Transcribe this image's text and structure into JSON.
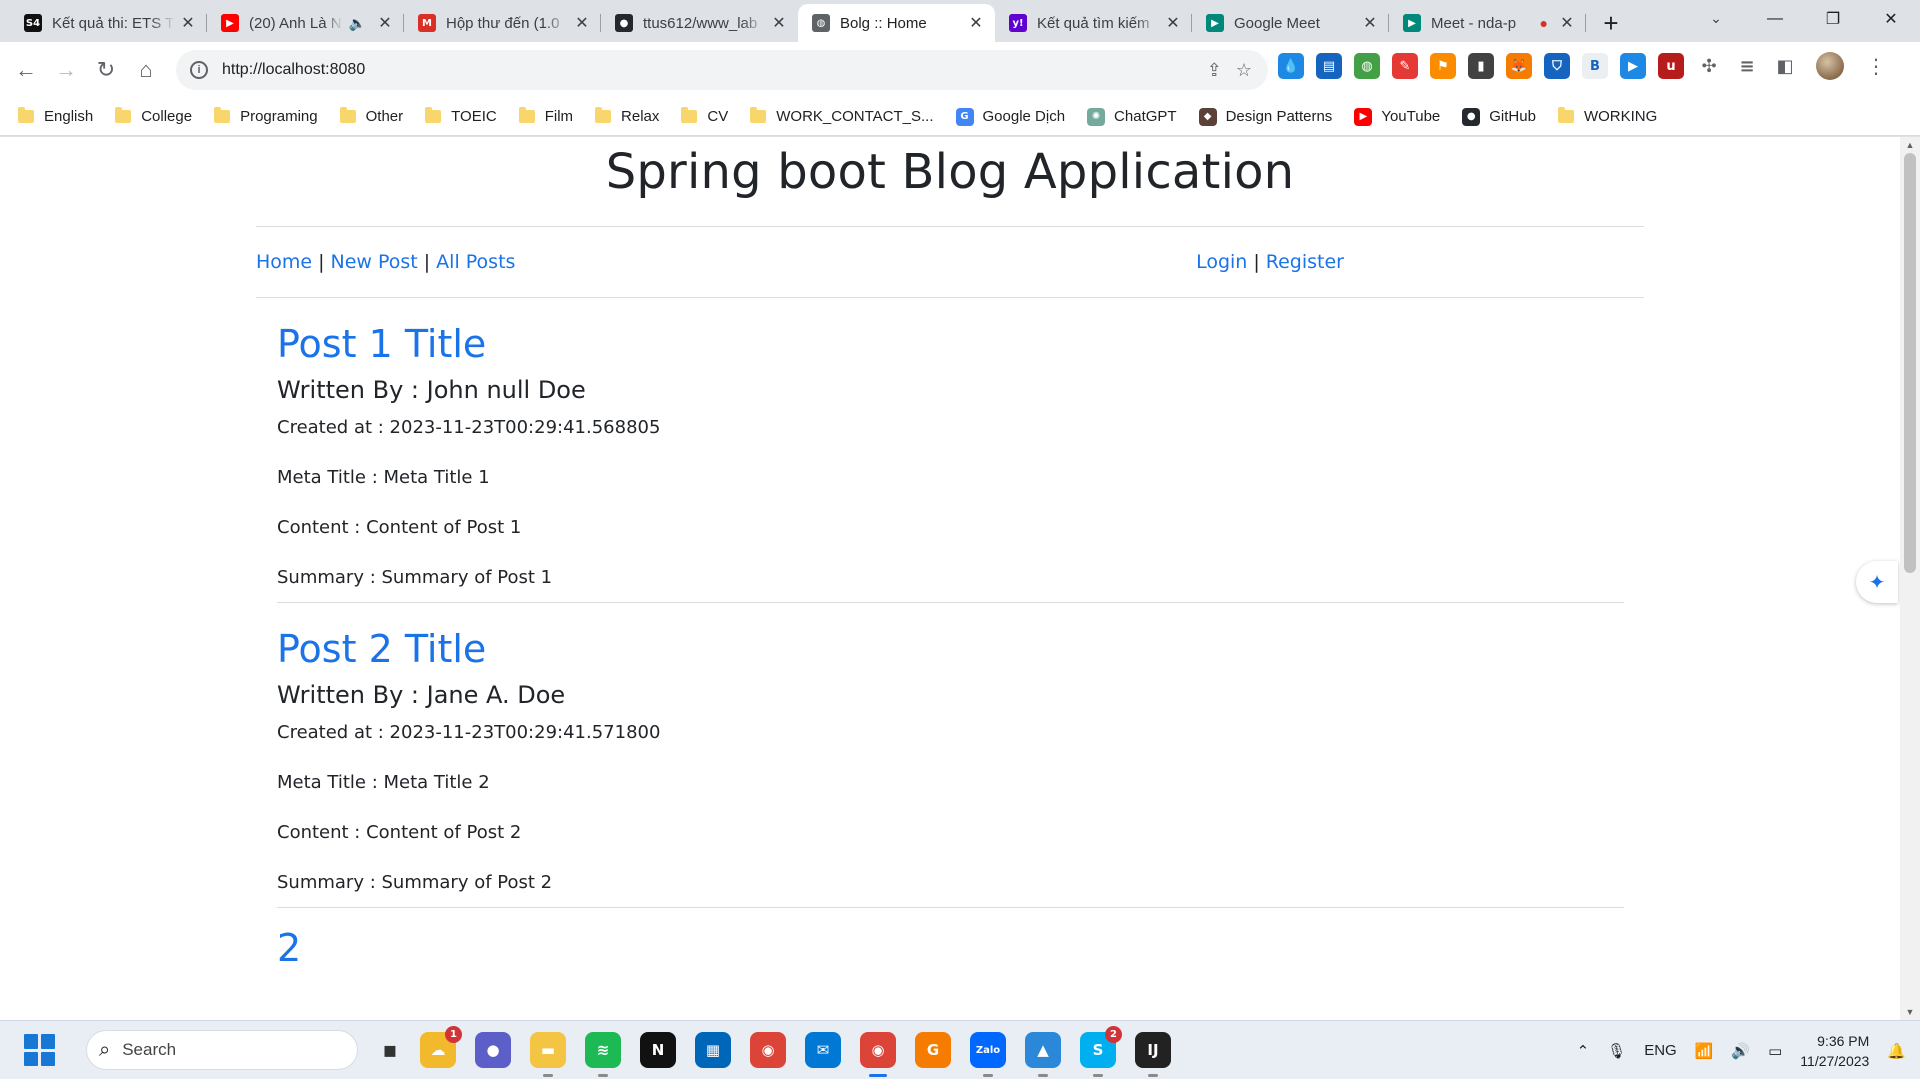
{
  "browser": {
    "tabs": [
      {
        "title": "Kết quả thi: ETS T",
        "icon": "s4-icon",
        "icon_text": "S4",
        "color": "#111111"
      },
      {
        "title": "(20) Anh Là N",
        "icon": "youtube-icon",
        "icon_text": "▶",
        "color": "#ff0000",
        "extra": "🔈"
      },
      {
        "title": "Hộp thư đến (1.0",
        "icon": "gmail-icon",
        "icon_text": "M",
        "color": "#d93025"
      },
      {
        "title": "ttus612/www_lab",
        "icon": "github-icon",
        "icon_text": "●",
        "color": "#24292f"
      },
      {
        "title": "Bolg :: Home",
        "icon": "globe-icon",
        "icon_text": "◍",
        "color": "#5f6368",
        "active": true
      },
      {
        "title": "Kết quả tìm kiếm",
        "icon": "yahoo-icon",
        "icon_text": "y!",
        "color": "#6001d2"
      },
      {
        "title": "Google Meet",
        "icon": "meet-icon",
        "icon_text": "▶",
        "color": "#00897b"
      },
      {
        "title": "Meet - nda-p",
        "icon": "meet-icon",
        "icon_text": "▶",
        "color": "#00897b",
        "extra": "●"
      }
    ],
    "url": "http://localhost:8080",
    "bookmarks": [
      {
        "label": "English",
        "type": "folder"
      },
      {
        "label": "College",
        "type": "folder"
      },
      {
        "label": "Programing",
        "type": "folder"
      },
      {
        "label": "Other",
        "type": "folder"
      },
      {
        "label": "TOEIC",
        "type": "folder"
      },
      {
        "label": "Film",
        "type": "folder"
      },
      {
        "label": "Relax",
        "type": "folder"
      },
      {
        "label": "CV",
        "type": "folder"
      },
      {
        "label": "WORK_CONTACT_S...",
        "type": "folder"
      },
      {
        "label": "Google Dịch",
        "type": "link",
        "icon": "google-translate-icon",
        "color": "#4285f4",
        "icon_text": "G"
      },
      {
        "label": "ChatGPT",
        "type": "link",
        "icon": "chatgpt-icon",
        "color": "#74aa9c",
        "icon_text": "✺"
      },
      {
        "label": "Design Patterns",
        "type": "link",
        "icon": "design-patterns-icon",
        "color": "#5d4037",
        "icon_text": "◆"
      },
      {
        "label": "YouTube",
        "type": "link",
        "icon": "youtube-icon",
        "color": "#ff0000",
        "icon_text": "▶"
      },
      {
        "label": "GitHub",
        "type": "link",
        "icon": "github-icon",
        "color": "#24292f",
        "icon_text": "●"
      },
      {
        "label": "WORKING",
        "type": "folder"
      }
    ]
  },
  "site": {
    "title": "Spring boot Blog Application",
    "nav_left": [
      "Home",
      "New Post",
      "All Posts"
    ],
    "nav_right": [
      "Login",
      "Register"
    ],
    "nav_separator": "|",
    "posts": [
      {
        "title": "Post 1 Title",
        "author": "Written By : John null Doe",
        "created": "Created at : 2023-11-23T00:29:41.568805",
        "meta": "Meta Title : Meta Title 1",
        "content": "Content : Content of Post 1",
        "summary": "Summary : Summary of Post 1"
      },
      {
        "title": "Post 2 Title",
        "author": "Written By : Jane A. Doe",
        "created": "Created at : 2023-11-23T00:29:41.571800",
        "meta": "Meta Title : Meta Title 2",
        "content": "Content : Content of Post 2",
        "summary": "Summary : Summary of Post 2"
      }
    ],
    "pager": "2"
  },
  "taskbar": {
    "search_placeholder": "Search",
    "apps": [
      {
        "name": "widgets-icon",
        "color": "#f2b92c",
        "text": "☁",
        "badge": "1"
      },
      {
        "name": "chat-icon",
        "color": "#5b5fc7",
        "text": "●"
      },
      {
        "name": "file-explorer-icon",
        "color": "#f4c542",
        "text": "▬",
        "running": true
      },
      {
        "name": "spotify-icon",
        "color": "#1db954",
        "text": "≋",
        "running": true
      },
      {
        "name": "notion-icon",
        "color": "#111111",
        "text": "N"
      },
      {
        "name": "store-icon",
        "color": "#0067b8",
        "text": "▦"
      },
      {
        "name": "chrome-icon",
        "color": "#db4437",
        "text": "◉"
      },
      {
        "name": "mail-icon",
        "color": "#0078d4",
        "text": "✉"
      },
      {
        "name": "chrome-active-icon",
        "color": "#db4437",
        "text": "◉",
        "running": true,
        "focused": true
      },
      {
        "name": "pdf-icon",
        "color": "#f57c00",
        "text": "G"
      },
      {
        "name": "zalo-icon",
        "color": "#0068ff",
        "text": "Zalo",
        "running": true
      },
      {
        "name": "photos-icon",
        "color": "#2b88d8",
        "text": "▲",
        "running": true
      },
      {
        "name": "skype-icon",
        "color": "#00aff0",
        "text": "S",
        "badge": "2",
        "running": true
      },
      {
        "name": "intellij-icon",
        "color": "#222222",
        "text": "IJ",
        "running": true
      }
    ],
    "language": "ENG",
    "time": "9:36 PM",
    "date": "11/27/2023"
  }
}
